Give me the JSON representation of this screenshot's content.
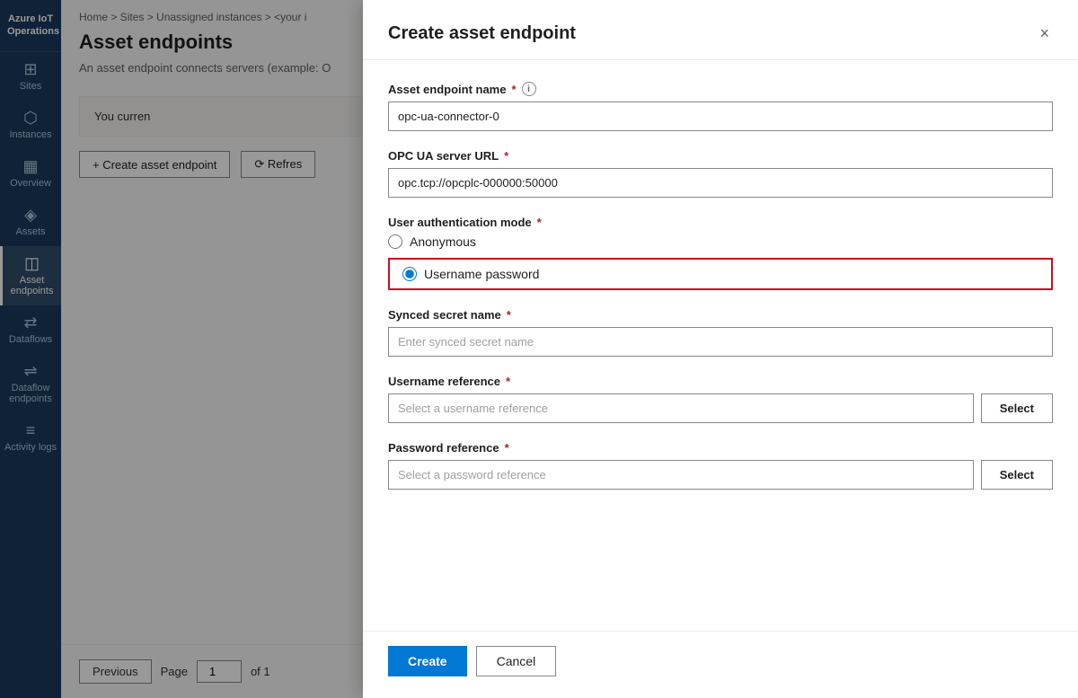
{
  "app": {
    "title": "Azure IoT Operations"
  },
  "sidebar": {
    "items": [
      {
        "id": "sites",
        "label": "Sites",
        "icon": "⊞"
      },
      {
        "id": "instances",
        "label": "Instances",
        "icon": "⬡"
      },
      {
        "id": "overview",
        "label": "Overview",
        "icon": "▦"
      },
      {
        "id": "assets",
        "label": "Assets",
        "icon": "◈"
      },
      {
        "id": "asset-endpoints",
        "label": "Asset endpoints",
        "icon": "◫",
        "active": true
      },
      {
        "id": "dataflows",
        "label": "Dataflows",
        "icon": "⇄"
      },
      {
        "id": "dataflow-endpoints",
        "label": "Dataflow endpoints",
        "icon": "⇌"
      },
      {
        "id": "activity-logs",
        "label": "Activity logs",
        "icon": "≡"
      }
    ]
  },
  "breadcrumb": {
    "text": "Home > Sites > Unassigned instances > <your i"
  },
  "page": {
    "title": "Asset endpoints",
    "subtitle": "An asset endpoint connects servers (example: O"
  },
  "content": {
    "info_text": "You curren"
  },
  "toolbar": {
    "create_label": "+ Create asset endpoint",
    "refresh_label": "⟳ Refres"
  },
  "pagination": {
    "previous_label": "Previous",
    "page_label": "Page",
    "page_value": "1",
    "of_label": "of 1"
  },
  "panel": {
    "title": "Create asset endpoint",
    "close_icon": "×",
    "fields": {
      "endpoint_name": {
        "label": "Asset endpoint name",
        "required": true,
        "has_info": true,
        "value": "opc-ua-connector-0",
        "placeholder": ""
      },
      "opc_ua_url": {
        "label": "OPC UA server URL",
        "required": true,
        "value": "opc.tcp://opcplc-000000:50000",
        "placeholder": ""
      },
      "auth_mode": {
        "label": "User authentication mode",
        "required": true,
        "options": [
          {
            "id": "anonymous",
            "label": "Anonymous",
            "checked": false
          },
          {
            "id": "username-password",
            "label": "Username password",
            "checked": true
          }
        ]
      },
      "synced_secret": {
        "label": "Synced secret name",
        "required": true,
        "value": "",
        "placeholder": "Enter synced secret name"
      },
      "username_ref": {
        "label": "Username reference",
        "required": true,
        "value": "",
        "placeholder": "Select a username reference",
        "select_label": "Select"
      },
      "password_ref": {
        "label": "Password reference",
        "required": true,
        "value": "",
        "placeholder": "Select a password reference",
        "select_label": "Select"
      }
    },
    "footer": {
      "create_label": "Create",
      "cancel_label": "Cancel"
    }
  }
}
